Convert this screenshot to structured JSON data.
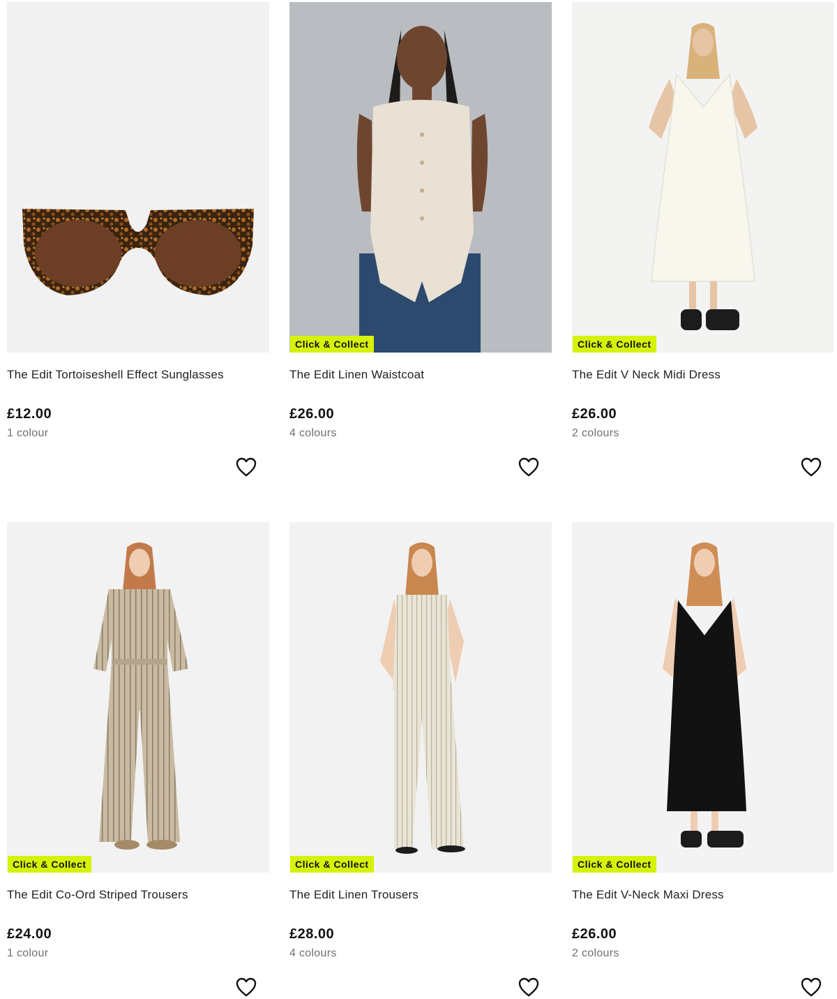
{
  "badge_label": "Click & Collect",
  "colors": {
    "badge_bg": "#d7f20a",
    "text": "#222222",
    "muted": "#6f6f6f"
  },
  "products": [
    {
      "title": "The Edit Tortoiseshell Effect Sunglasses",
      "price": "£12.00",
      "colours": "1 colour",
      "badge": false,
      "image": "sunglasses"
    },
    {
      "title": "The Edit Linen Waistcoat",
      "price": "£26.00",
      "colours": "4 colours",
      "badge": true,
      "image": "waistcoat"
    },
    {
      "title": "The Edit V Neck Midi Dress",
      "price": "£26.00",
      "colours": "2 colours",
      "badge": true,
      "image": "white-dress"
    },
    {
      "title": "The Edit Co-Ord Striped Trousers",
      "price": "£24.00",
      "colours": "1 colour",
      "badge": true,
      "image": "striped-set"
    },
    {
      "title": "The Edit Linen Trousers",
      "price": "£28.00",
      "colours": "4 colours",
      "badge": true,
      "image": "linen-set"
    },
    {
      "title": "The Edit V-Neck Maxi Dress",
      "price": "£26.00",
      "colours": "2 colours",
      "badge": true,
      "image": "black-dress"
    }
  ],
  "icons": {
    "wishlist": "heart-outline-icon"
  }
}
